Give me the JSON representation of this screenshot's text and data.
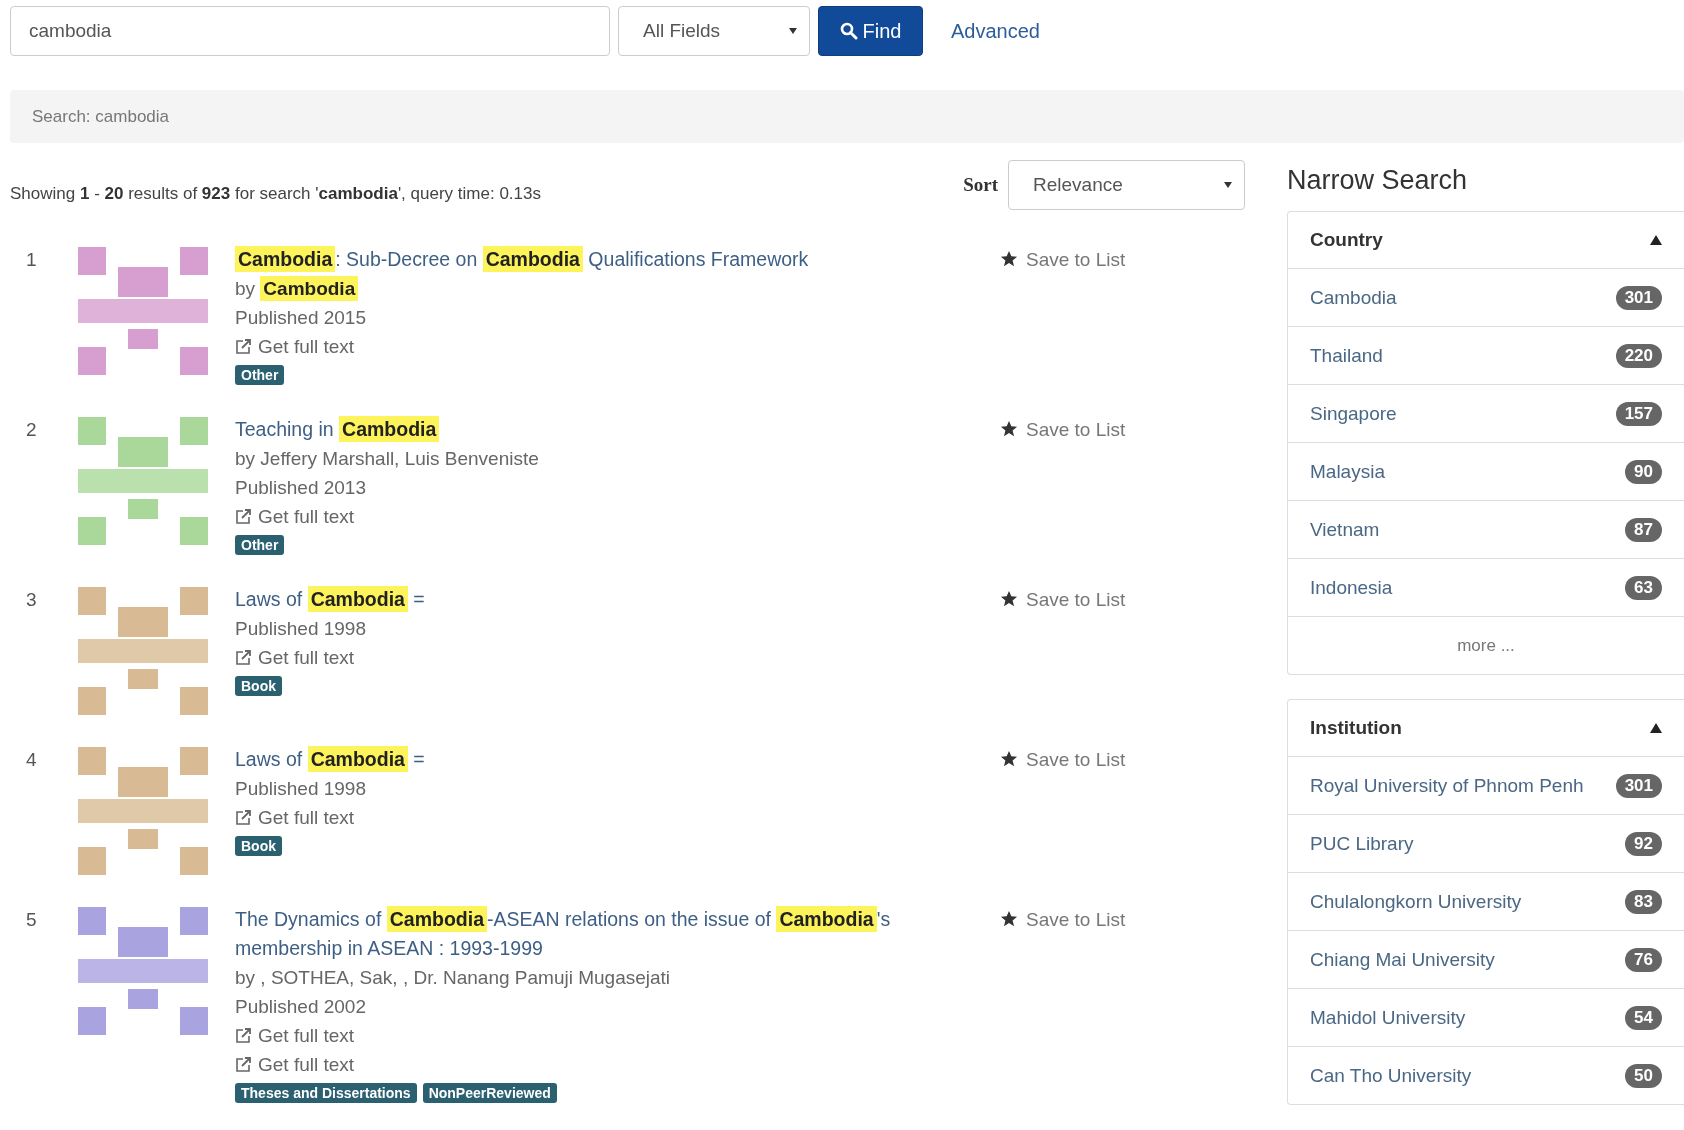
{
  "search": {
    "value": "cambodia",
    "field_type": "All Fields",
    "find_button": "Find",
    "advanced_link": "Advanced"
  },
  "breadcrumb": "Search: cambodia",
  "summary": "Showing **1** - **20** results of **923** for search '**cambodia**', query time: 0.13s",
  "sort": {
    "label": "Sort",
    "value": "Relevance"
  },
  "results": [
    {
      "number": "1",
      "color": "#d79fd0",
      "title": [
        {
          "text": "Cambodia",
          "highlight": true
        },
        {
          "text": ": Sub-Decree on ",
          "highlight": false
        },
        {
          "text": "Cambodia",
          "highlight": true
        },
        {
          "text": " Qualifications Framework",
          "highlight": false
        }
      ],
      "author": [
        {
          "text": "by ",
          "highlight": false
        },
        {
          "text": "Cambodia",
          "highlight": true
        }
      ],
      "published": "Published 2015",
      "links": [
        "Get full text"
      ],
      "formats": [
        "Other"
      ],
      "save": "Save to List"
    },
    {
      "number": "2",
      "color": "#a9d89a",
      "title": [
        {
          "text": "Teaching in ",
          "highlight": false
        },
        {
          "text": "Cambodia",
          "highlight": true
        }
      ],
      "author": [
        {
          "text": "by Jeffery Marshall, Luis Benveniste",
          "highlight": false
        }
      ],
      "published": "Published 2013",
      "links": [
        "Get full text"
      ],
      "formats": [
        "Other"
      ],
      "save": "Save to List"
    },
    {
      "number": "3",
      "color": "#d8bb94",
      "title": [
        {
          "text": "Laws of ",
          "highlight": false
        },
        {
          "text": "Cambodia",
          "highlight": true
        },
        {
          "text": " =",
          "highlight": false
        }
      ],
      "published": "Published 1998",
      "links": [
        "Get full text"
      ],
      "formats": [
        "Book"
      ],
      "save": "Save to List"
    },
    {
      "number": "4",
      "color": "#d8bb94",
      "title": [
        {
          "text": "Laws of ",
          "highlight": false
        },
        {
          "text": "Cambodia",
          "highlight": true
        },
        {
          "text": " =",
          "highlight": false
        }
      ],
      "published": "Published 1998",
      "links": [
        "Get full text"
      ],
      "formats": [
        "Book"
      ],
      "save": "Save to List"
    },
    {
      "number": "5",
      "color": "#a9a3e0",
      "title": [
        {
          "text": "The Dynamics of ",
          "highlight": false
        },
        {
          "text": "Cambodia",
          "highlight": true
        },
        {
          "text": "-ASEAN relations on the issue of ",
          "highlight": false
        },
        {
          "text": "Cambodia",
          "highlight": true
        },
        {
          "text": "'s membership in ASEAN : 1993-1999",
          "highlight": false
        }
      ],
      "author": [
        {
          "text": "by , SOTHEA, Sak, , Dr. Nanang Pamuji Mugasejati",
          "highlight": false
        }
      ],
      "published": "Published 2002",
      "links": [
        "Get full text",
        "Get full text"
      ],
      "formats": [
        "Theses and Dissertations",
        "NonPeerReviewed"
      ],
      "save": "Save to List"
    }
  ],
  "narrow_search": {
    "title": "Narrow Search",
    "facets": [
      {
        "title": "Country",
        "expanded": true,
        "items": [
          {
            "label": "Cambodia",
            "count": "301"
          },
          {
            "label": "Thailand",
            "count": "220"
          },
          {
            "label": "Singapore",
            "count": "157"
          },
          {
            "label": "Malaysia",
            "count": "90"
          },
          {
            "label": "Vietnam",
            "count": "87"
          },
          {
            "label": "Indonesia",
            "count": "63"
          }
        ],
        "more": "more ..."
      },
      {
        "title": "Institution",
        "expanded": true,
        "items": [
          {
            "label": "Royal University of Phnom Penh",
            "count": "301"
          },
          {
            "label": "PUC Library",
            "count": "92"
          },
          {
            "label": "Chulalongkorn University",
            "count": "83"
          },
          {
            "label": "Chiang Mai University",
            "count": "76"
          },
          {
            "label": "Mahidol University",
            "count": "54"
          },
          {
            "label": "Can Tho University",
            "count": "50"
          }
        ]
      }
    ]
  }
}
